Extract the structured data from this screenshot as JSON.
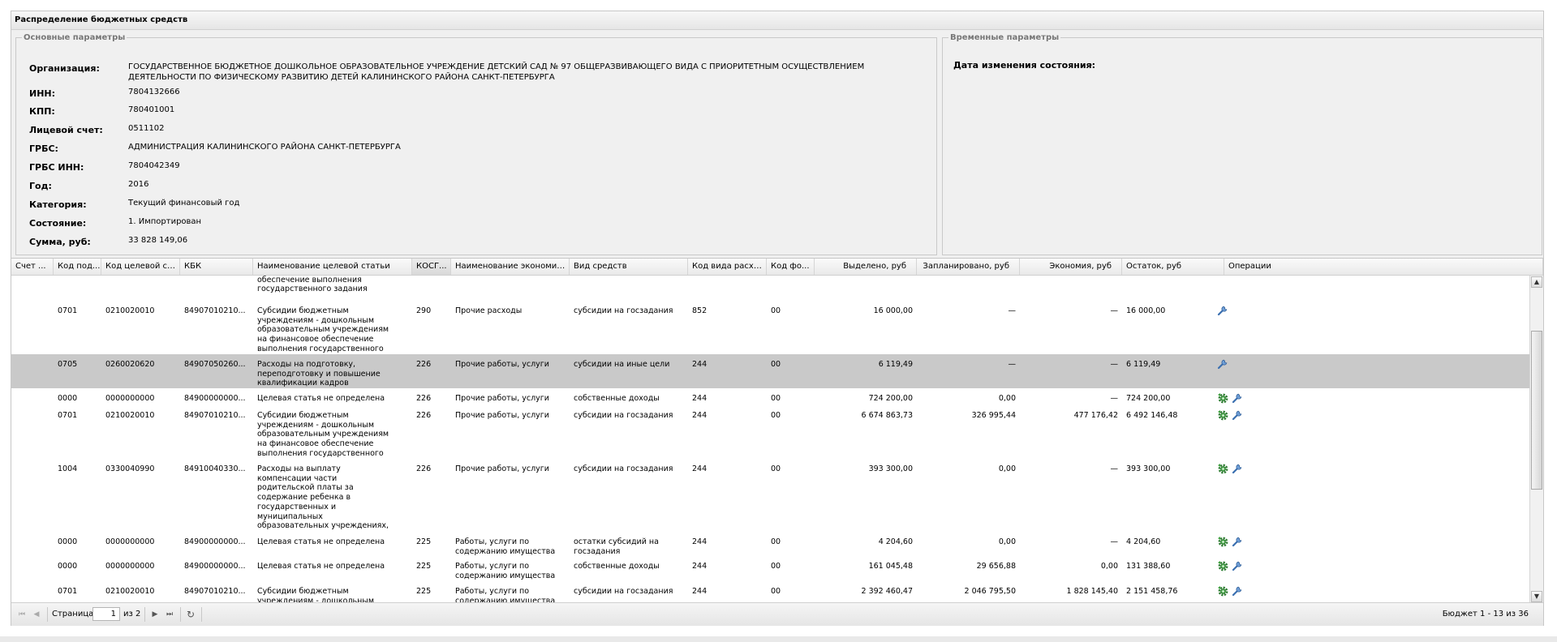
{
  "window": {
    "title": "Распределение бюджетных средств"
  },
  "main_params": {
    "legend": "Основные параметры",
    "fields": [
      {
        "label": "Организация:",
        "value": "ГОСУДАРСТВЕННОЕ БЮДЖЕТНОЕ ДОШКОЛЬНОЕ ОБРАЗОВАТЕЛЬНОЕ УЧРЕЖДЕНИЕ ДЕТСКИЙ САД № 97 ОБЩЕРАЗВИВАЮЩЕГО ВИДА С ПРИОРИТЕТНЫМ ОСУЩЕСТВЛЕНИЕМ ДЕЯТЕЛЬНОСТИ ПО ФИЗИЧЕСКОМУ РАЗВИТИЮ ДЕТЕЙ КАЛИНИНСКОГО РАЙОНА САНКТ-ПЕТЕРБУРГА"
      },
      {
        "label": "ИНН:",
        "value": "7804132666"
      },
      {
        "label": "КПП:",
        "value": "780401001"
      },
      {
        "label": "Лицевой счет:",
        "value": "0511102"
      },
      {
        "label": "ГРБС:",
        "value": "АДМИНИСТРАЦИЯ КАЛИНИНСКОГО РАЙОНА САНКТ-ПЕТЕРБУРГА"
      },
      {
        "label": "ГРБС ИНН:",
        "value": "7804042349"
      },
      {
        "label": "Год:",
        "value": "2016"
      },
      {
        "label": "Категория:",
        "value": "Текущий финансовый год"
      },
      {
        "label": "Состояние:",
        "value": "1. Импортирован"
      },
      {
        "label": "Сумма, руб:",
        "value": "33 828 149,06"
      }
    ]
  },
  "time_params": {
    "legend": "Временные параметры",
    "label": "Дата изменения состояния:",
    "value": "-"
  },
  "grid": {
    "columns": [
      "Счет ...",
      "Код под...",
      "Код целевой ст...",
      "КБК",
      "Наименование целевой статьи",
      "КОСГ...",
      "Наименование экономич...",
      "Вид средств",
      "Код вида расхо...",
      "Код фо...",
      "Выделено, руб",
      "Запланировано, руб",
      "Экономия, руб",
      "Остаток, руб",
      "Операции"
    ],
    "rows": [
      {
        "partial": true,
        "cells": [
          "",
          "",
          "",
          "",
          "учреждениям на финансовое обеспечение выполнения государственного задания",
          "",
          "",
          "",
          "",
          "",
          "",
          "",
          "",
          ""
        ],
        "ops": []
      },
      {
        "cells": [
          "",
          "0701",
          "0210020010",
          "84907010210...",
          "Субсидии бюджетным учреждениям - дошкольным образовательным учреждениям на финансовое обеспечение выполнения государственного задания",
          "290",
          "Прочие расходы",
          "субсидии на госзадания",
          "852",
          "00",
          "16 000,00",
          "—",
          "—",
          "16 000,00"
        ],
        "ops": [
          "wrench"
        ]
      },
      {
        "selected": true,
        "cells": [
          "",
          "0705",
          "0260020620",
          "84907050260...",
          "Расходы на подготовку, переподготовку и повышение квалификации кадров",
          "226",
          "Прочие работы, услуги",
          "субсидии на иные цели",
          "244",
          "00",
          "6 119,49",
          "—",
          "—",
          "6 119,49"
        ],
        "ops": [
          "wrench"
        ]
      },
      {
        "cells": [
          "",
          "0000",
          "0000000000",
          "84900000000...",
          "Целевая статья не определена",
          "226",
          "Прочие работы, услуги",
          "собственные доходы",
          "244",
          "00",
          "724 200,00",
          "0,00",
          "—",
          "724 200,00"
        ],
        "ops": [
          "gear",
          "wrench"
        ]
      },
      {
        "cells": [
          "",
          "0701",
          "0210020010",
          "84907010210...",
          "Субсидии бюджетным учреждениям - дошкольным образовательным учреждениям на финансовое обеспечение выполнения государственного задания",
          "226",
          "Прочие работы, услуги",
          "субсидии на госзадания",
          "244",
          "00",
          "6 674 863,73",
          "326 995,44",
          "477 176,42",
          "6 492 146,48"
        ],
        "ops": [
          "gear",
          "wrench"
        ]
      },
      {
        "cells": [
          "",
          "1004",
          "0330040990",
          "84910040330...",
          "Расходы на выплату компенсации части родительской платы за содержание ребенка в государственных и муниципальных образовательных учреждениях, реализующих общеобразовательную программу дошкольного образования",
          "226",
          "Прочие работы, услуги",
          "субсидии на госзадания",
          "244",
          "00",
          "393 300,00",
          "0,00",
          "—",
          "393 300,00"
        ],
        "ops": [
          "gear",
          "wrench"
        ]
      },
      {
        "cells": [
          "",
          "0000",
          "0000000000",
          "84900000000...",
          "Целевая статья не определена",
          "225",
          "Работы, услуги по содержанию имущества",
          "остатки субсидий на госзадания",
          "244",
          "00",
          "4 204,60",
          "0,00",
          "—",
          "4 204,60"
        ],
        "ops": [
          "gear",
          "wrench"
        ]
      },
      {
        "cells": [
          "",
          "0000",
          "0000000000",
          "84900000000...",
          "Целевая статья не определена",
          "225",
          "Работы, услуги по содержанию имущества",
          "собственные доходы",
          "244",
          "00",
          "161 045,48",
          "29 656,88",
          "0,00",
          "131 388,60"
        ],
        "ops": [
          "gear",
          "wrench"
        ]
      },
      {
        "cells": [
          "",
          "0701",
          "0210020010",
          "84907010210...",
          "Субсидии бюджетным учреждениям - дошкольным образовательным",
          "225",
          "Работы, услуги по содержанию имущества",
          "субсидии на госзадания",
          "244",
          "00",
          "2 392 460,47",
          "2 046 795,50",
          "1 828 145,40",
          "2 151 458,76"
        ],
        "ops": [
          "gear",
          "wrench"
        ]
      }
    ]
  },
  "pager": {
    "page_label": "Страница",
    "page_value": "1",
    "of_label": "из 2",
    "info": "Бюджет 1 - 13 из 36"
  },
  "colors": {
    "panel_bg": "#f0f0f0",
    "selected_row": "#c9c9c9",
    "header_border": "#c7c7c7",
    "gear_icon": "#2e9a2e",
    "wrench_icon": "#3a6fb0"
  }
}
